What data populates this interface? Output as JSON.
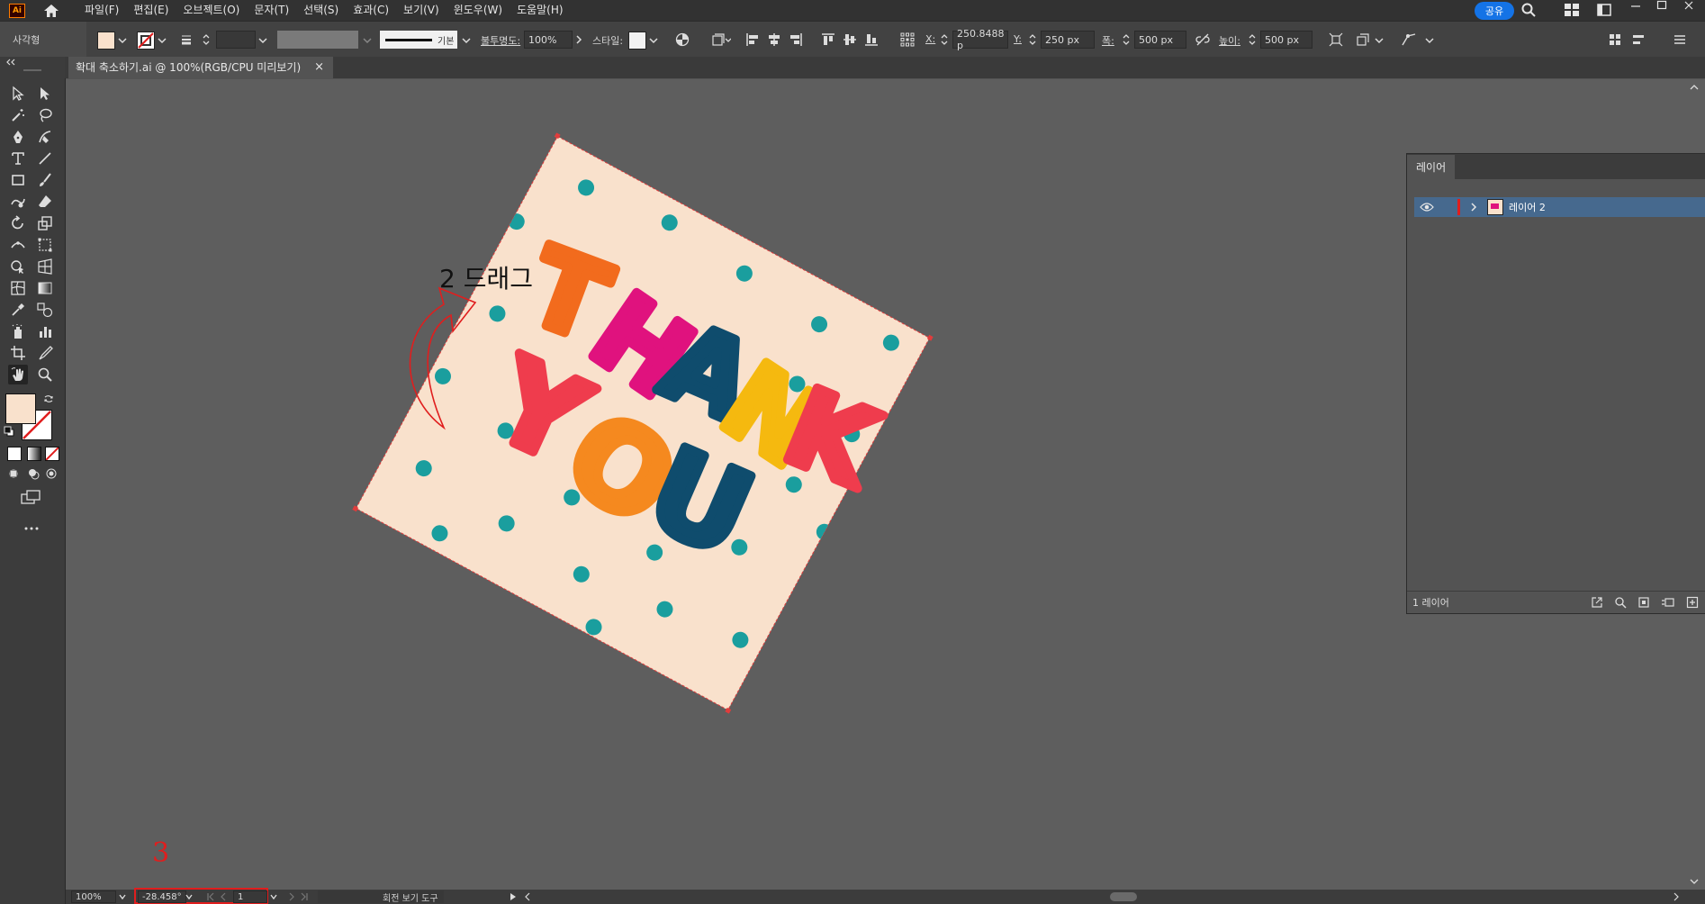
{
  "app": {
    "logo_text": "Ai",
    "share_label": "공유"
  },
  "menus": [
    "파일(F)",
    "편집(E)",
    "오브젝트(O)",
    "문자(T)",
    "선택(S)",
    "효과(C)",
    "보기(V)",
    "윈도우(W)",
    "도움말(H)"
  ],
  "control_bar": {
    "object_type": "사각형",
    "stroke_style": "기본",
    "opacity_label": "불투명도:",
    "opacity_value": "100%",
    "style_label": "스타일:",
    "x_label": "X:",
    "x_value": "250.8488 p",
    "y_label": "Y:",
    "y_value": "250 px",
    "w_label": "폭:",
    "w_value": "500 px",
    "h_label": "높이:",
    "h_value": "500 px"
  },
  "document_tab": {
    "title": "확대 축소하기.ai @ 100%(RGB/CPU 미리보기)",
    "close": "×"
  },
  "canvas": {
    "annotation_drag": "2 드래그",
    "annotation_step3": "3",
    "artwork_word1": "THANK",
    "artwork_word2": "YOU",
    "artwork_bg": "#f9e1cc",
    "dot_color": "#1a9e9e"
  },
  "layers_panel": {
    "tab_label": "레이어",
    "layer_name": "레이어 2",
    "footer_count": "1 레이어"
  },
  "status_bar": {
    "zoom": "100%",
    "rotation": "-28.458°",
    "artboard": "1",
    "tool_name": "회전 보기 도구"
  },
  "colors": {
    "accent": "#1473e6",
    "highlight": "#e01e1e",
    "selection": "#46698e"
  }
}
